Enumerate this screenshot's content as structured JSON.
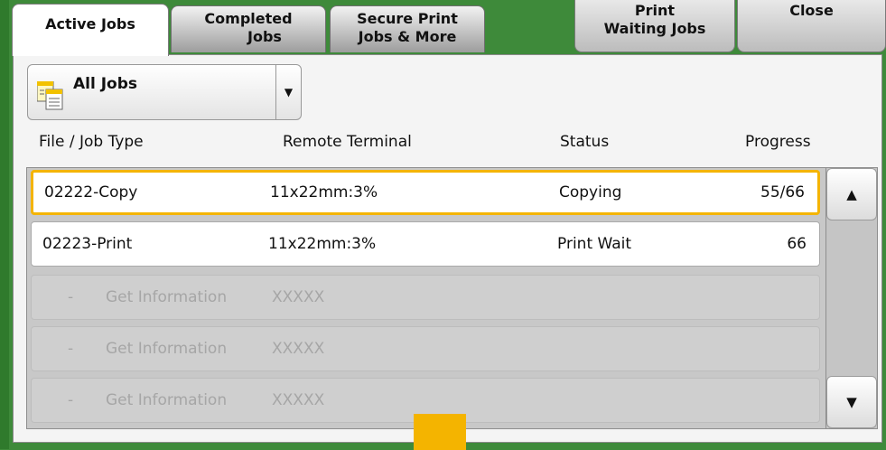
{
  "tabs": {
    "active_jobs": "Active Jobs",
    "completed_jobs": [
      "Completed",
      "Jobs"
    ],
    "secure_print": [
      "Secure Print",
      "Jobs & More"
    ]
  },
  "actions": {
    "print_waiting": [
      "Print",
      "Waiting Jobs"
    ],
    "close": "Close"
  },
  "filter": {
    "selected": "All Jobs"
  },
  "columns": [
    "File / Job Type",
    "Remote Terminal",
    "Status",
    "Progress"
  ],
  "rows": [
    {
      "id": "02222",
      "type": "Copy",
      "terminal": "11x22mm:3%",
      "status": "Copying",
      "progress": "55/66"
    },
    {
      "id": "02223",
      "type": "Print",
      "terminal": "11x22mm:3%",
      "status": "Print Wait",
      "progress": "66"
    }
  ],
  "placeholder_rows": [
    {
      "dash": "-",
      "label": "Get Information",
      "terminal": "XXXXX"
    },
    {
      "dash": "-",
      "label": "Get Information",
      "terminal": "XXXXX"
    },
    {
      "dash": "-",
      "label": "Get Information",
      "terminal": "XXXXX"
    }
  ],
  "scroll": {
    "up": "▲",
    "down": "▼"
  },
  "colors": {
    "frame": "#3e8a3a",
    "selection": "#f4b400"
  }
}
